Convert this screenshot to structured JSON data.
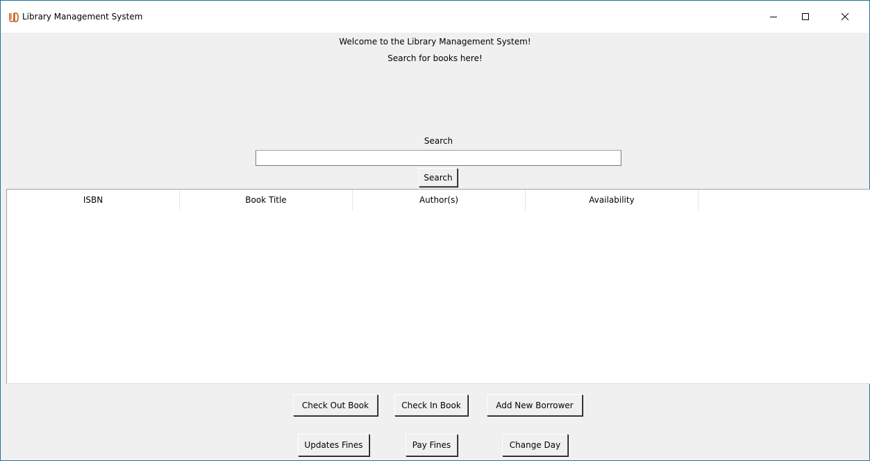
{
  "window": {
    "title": "Library Management System",
    "icon": "utd-logo-icon",
    "controls": [
      "minimize-icon",
      "maximize-icon",
      "close-icon"
    ]
  },
  "welcome": {
    "line1": "Welcome to the Library Management System!",
    "line2": "Search for books here!"
  },
  "search": {
    "label": "Search",
    "value": "",
    "button_label": "Search"
  },
  "table": {
    "columns": [
      "ISBN",
      "Book Title",
      "Author(s)",
      "Availability"
    ],
    "rows": []
  },
  "actions": {
    "check_out": "Check Out Book",
    "check_in": "Check In Book",
    "add_borrower": "Add New Borrower",
    "update_fines": "Updates Fines",
    "pay_fines": "Pay Fines",
    "change_day": "Change Day"
  },
  "colors": {
    "window_border": "#1f6f9a",
    "icon_accent": "#c75b12",
    "background": "#f0f0f0"
  }
}
